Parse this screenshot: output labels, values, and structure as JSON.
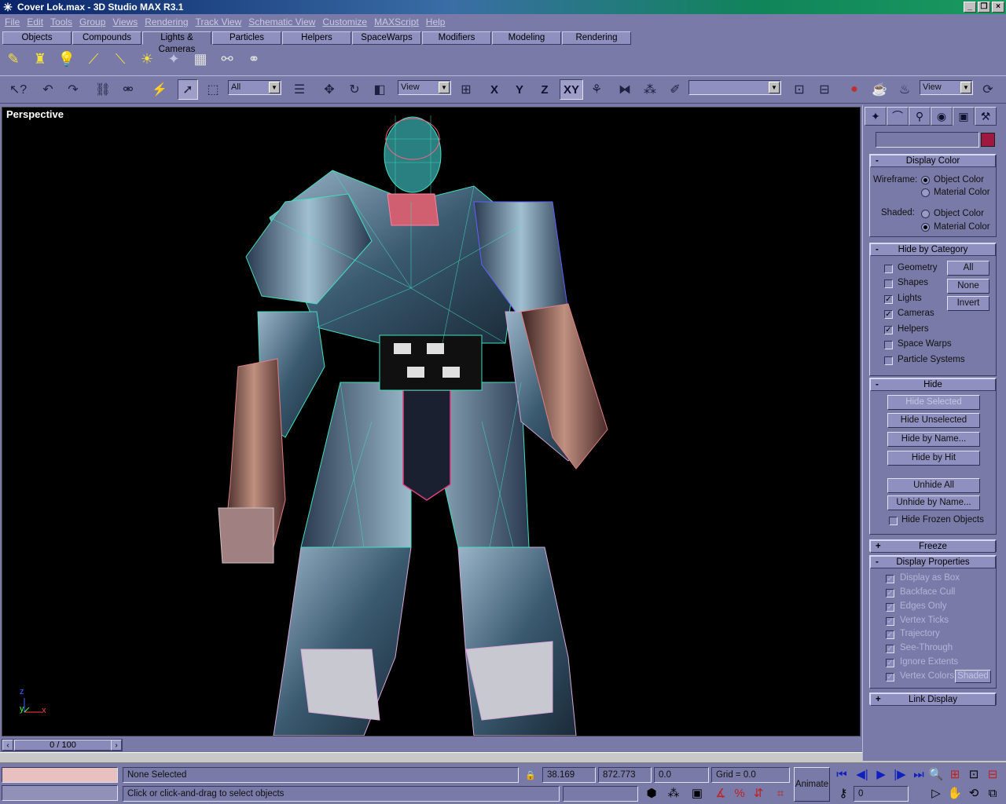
{
  "window": {
    "title": "Cover Lok.max - 3D Studio MAX R3.1"
  },
  "menu": [
    "File",
    "Edit",
    "Tools",
    "Group",
    "Views",
    "Rendering",
    "Track View",
    "Schematic View",
    "Customize",
    "MAXScript",
    "Help"
  ],
  "tabs": [
    "Objects",
    "Compounds",
    "Lights & Cameras",
    "Particles",
    "Helpers",
    "SpaceWarps",
    "Modifiers",
    "Modeling",
    "Rendering"
  ],
  "toolbar": {
    "selection_filter": "All",
    "ref_coord": "View",
    "axis_x": "X",
    "axis_y": "Y",
    "axis_z": "Z",
    "axis_xy": "XY",
    "named_selection": "",
    "render_type": "View"
  },
  "viewport": {
    "label": "Perspective",
    "axis_x": "x",
    "axis_y": "y",
    "axis_z": "z"
  },
  "time": {
    "frame": "0 / 100"
  },
  "status": {
    "selection": "None Selected",
    "prompt": "Click or click-and-drag to select objects",
    "x": "38.169",
    "y": "872.773",
    "z": "0.0",
    "grid": "Grid = 0.0",
    "animate": "Animate",
    "current_frame": "0"
  },
  "command_panel": {
    "display_color": {
      "title": "Display Color",
      "wireframe_label": "Wireframe:",
      "shaded_label": "Shaded:",
      "object_color": "Object Color",
      "material_color": "Material Color"
    },
    "hide_by_category": {
      "title": "Hide by Category",
      "items": [
        "Geometry",
        "Shapes",
        "Lights",
        "Cameras",
        "Helpers",
        "Space Warps",
        "Particle Systems"
      ],
      "checked": [
        false,
        false,
        true,
        true,
        true,
        false,
        false
      ],
      "all": "All",
      "none": "None",
      "invert": "Invert"
    },
    "hide": {
      "title": "Hide",
      "hide_selected": "Hide Selected",
      "hide_unselected": "Hide Unselected",
      "hide_by_name": "Hide by Name...",
      "hide_by_hit": "Hide by Hit",
      "unhide_all": "Unhide All",
      "unhide_by_name": "Unhide by Name...",
      "hide_frozen": "Hide Frozen Objects"
    },
    "freeze": {
      "title": "Freeze"
    },
    "display_properties": {
      "title": "Display Properties",
      "items": [
        "Display as Box",
        "Backface Cull",
        "Edges Only",
        "Vertex Ticks",
        "Trajectory",
        "See-Through",
        "Ignore Extents",
        "Vertex Colors"
      ],
      "shaded": "Shaded"
    },
    "link_display": {
      "title": "Link Display"
    }
  }
}
